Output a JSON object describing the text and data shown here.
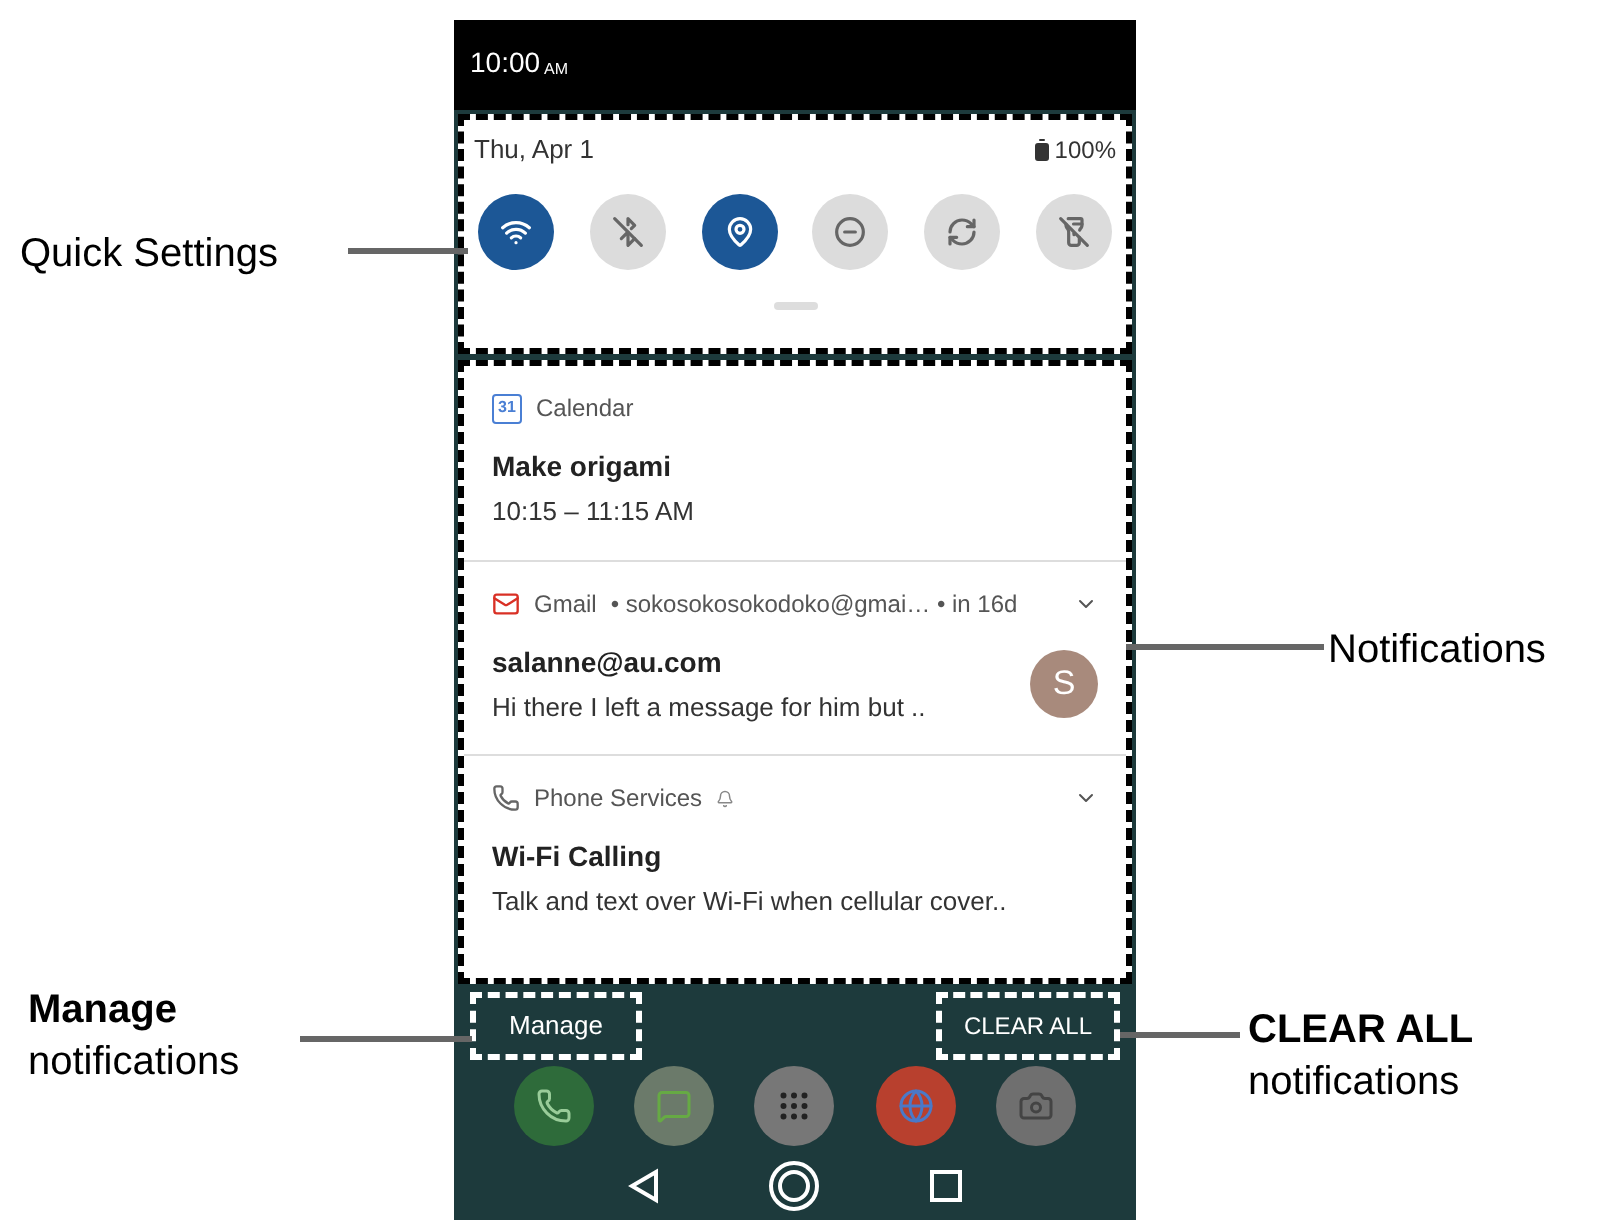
{
  "status_bar": {
    "time": "10:00",
    "ampm": "AM"
  },
  "quick_settings": {
    "callout": "Quick Settings",
    "date": "Thu, Apr 1",
    "battery": "100%",
    "tiles": [
      {
        "kind": "wifi",
        "on": true
      },
      {
        "kind": "bluetooth",
        "on": false
      },
      {
        "kind": "location",
        "on": true
      },
      {
        "kind": "dnd",
        "on": false
      },
      {
        "kind": "rotate",
        "on": false
      },
      {
        "kind": "flashlight",
        "on": false
      }
    ]
  },
  "notifications": {
    "callout": "Notifications",
    "items": [
      {
        "kind": "calendar",
        "badge": "31",
        "app": "Calendar",
        "title": "Make origami",
        "text": "10:15 – 11:15 AM"
      },
      {
        "kind": "gmail",
        "app": "Gmail",
        "meta": "• sokosokosokodoko@gmai… • in 16d",
        "title": "salanne@au.com",
        "text": "Hi there I left a message for him but ..",
        "avatar": "S"
      },
      {
        "kind": "phone",
        "app": "Phone Services",
        "title": "Wi-Fi Calling",
        "text": "Talk and text over Wi-Fi when cellular cover.."
      }
    ]
  },
  "manage": {
    "button": "Manage",
    "callout_bold": "Manage",
    "callout": "notifications"
  },
  "clear_all": {
    "button": "CLEAR ALL",
    "callout_bold": "CLEAR ALL",
    "callout": "notifications"
  }
}
